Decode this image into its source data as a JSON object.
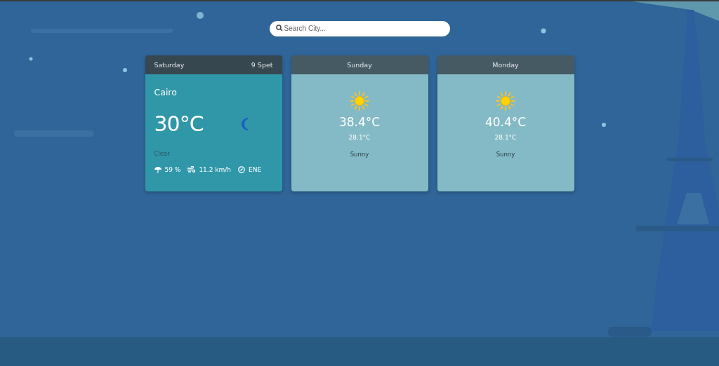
{
  "search": {
    "placeholder": "Search City..."
  },
  "today": {
    "day": "Saturday",
    "date": "9 Spet",
    "city": "Cairo",
    "temperature": "30°C",
    "kind": "moon",
    "condition": "Clear",
    "stats": [
      {
        "kind": "humidity",
        "value": "59 %"
      },
      {
        "kind": "wind",
        "value": "11.2 km/h"
      },
      {
        "kind": "direction",
        "value": "ENE"
      }
    ]
  },
  "forecast": [
    {
      "day": "Sunday",
      "kind": "sun",
      "high": "38.4°C",
      "low": "28.1°C",
      "condition": "Sunny"
    },
    {
      "day": "Monday",
      "kind": "sun",
      "high": "40.4°C",
      "low": "28.1°C",
      "condition": "Sunny"
    }
  ]
}
